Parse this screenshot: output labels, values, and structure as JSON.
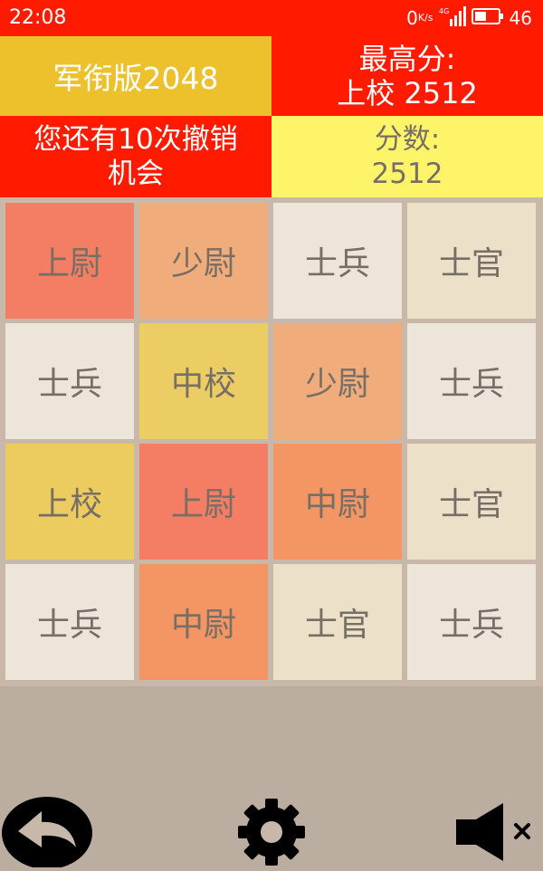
{
  "status_bar": {
    "time": "22:08",
    "net_speed": "0",
    "net_speed_unit": "K/s",
    "network_label": "4G",
    "battery_level": "46"
  },
  "header": {
    "title": "军衔版2048",
    "best_label": "最高分:",
    "best_value": "上校 2512",
    "undo_line1": "您还有10次撤销",
    "undo_line2": "机会",
    "score_label": "分数:",
    "score_value": "2512"
  },
  "board": {
    "rows": [
      [
        {
          "label": "上尉",
          "color": "#f47e63"
        },
        {
          "label": "少尉",
          "color": "#f0ac7a"
        },
        {
          "label": "士兵",
          "color": "#ede4da"
        },
        {
          "label": "士官",
          "color": "#ede0c8"
        }
      ],
      [
        {
          "label": "士兵",
          "color": "#ede4da"
        },
        {
          "label": "中校",
          "color": "#ebcd63"
        },
        {
          "label": "少尉",
          "color": "#f0ac7a"
        },
        {
          "label": "士兵",
          "color": "#ede4da"
        }
      ],
      [
        {
          "label": "上校",
          "color": "#eccb5f"
        },
        {
          "label": "上尉",
          "color": "#f47e63"
        },
        {
          "label": "中尉",
          "color": "#f39664"
        },
        {
          "label": "士官",
          "color": "#ede0c8"
        }
      ],
      [
        {
          "label": "士兵",
          "color": "#ede4da"
        },
        {
          "label": "中尉",
          "color": "#f39664"
        },
        {
          "label": "士官",
          "color": "#ede0c8"
        },
        {
          "label": "士兵",
          "color": "#ede4da"
        }
      ]
    ]
  },
  "controls": {
    "back_icon": "undo-arrow-icon",
    "settings_icon": "gear-icon",
    "sound_icon": "speaker-muted-icon"
  },
  "colors": {
    "accent_red": "#ff1a00",
    "title_gold": "#ecc12c",
    "score_yellow": "#fef46a",
    "background": "#bbada0"
  }
}
